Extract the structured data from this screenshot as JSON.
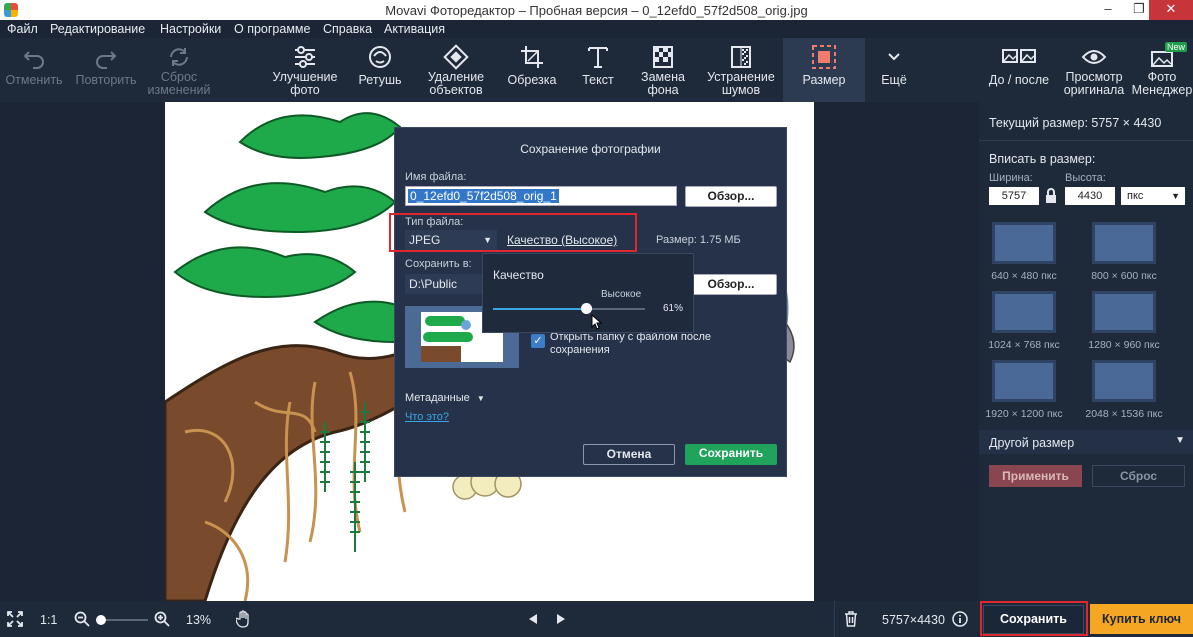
{
  "window": {
    "title": "Movavi Фоторедактор – Пробная версия – 0_12efd0_57f2d508_orig.jpg"
  },
  "menu": [
    "Файл",
    "Редактирование",
    "Настройки",
    "О программе",
    "Справка",
    "Активация"
  ],
  "toolbar": {
    "undo": "Отменить",
    "redo": "Повторить",
    "reset": [
      "Сброс",
      "изменений"
    ],
    "tools": [
      {
        "label": [
          "Улучшение",
          "фото"
        ]
      },
      {
        "label": [
          "Ретушь"
        ]
      },
      {
        "label": [
          "Удаление",
          "объектов"
        ]
      },
      {
        "label": [
          "Обрезка"
        ]
      },
      {
        "label": [
          "Текст"
        ]
      },
      {
        "label": [
          "Замена",
          "фона"
        ]
      },
      {
        "label": [
          "Устранение",
          "шумов"
        ]
      },
      {
        "label": [
          "Размер"
        ]
      },
      {
        "label": [
          "Ещё"
        ]
      }
    ],
    "before_after": "До / после",
    "view_original": [
      "Просмотр",
      "оригинала"
    ],
    "photo_manager": [
      "Фото",
      "Менеджер"
    ],
    "new_badge": "New"
  },
  "right_panel": {
    "current_size": "Текущий размер: 5757 × 4430",
    "fit_to_size": "Вписать в размер:",
    "width_label": "Ширина:",
    "height_label": "Высота:",
    "width_value": "5757",
    "height_value": "4430",
    "unit": "пкс",
    "presets": [
      "640 × 480 пкс",
      "800 × 600 пкс",
      "1024 × 768 пкс",
      "1280 × 960 пкс",
      "1920 × 1200 пкс",
      "2048 × 1536 пкс"
    ],
    "other_size": "Другой размер",
    "apply": "Применить",
    "reset": "Сброс"
  },
  "dialog": {
    "title": "Сохранение фотографии",
    "filename_label": "Имя файла:",
    "filename_value": "0_12efd0_57f2d508_orig_1",
    "browse": "Обзор...",
    "filetype_label": "Тип файла:",
    "filetype_value": "JPEG",
    "quality_link": "Качество (Высокое)",
    "size": "Размер: 1.75 МБ",
    "save_to_label": "Сохранить в:",
    "save_to_value": "D:\\Public",
    "browse2": "Обзор...",
    "open_folder": [
      "Открыть папку с файлом после",
      "сохранения"
    ],
    "metadata": "Метаданные",
    "what_is": "Что это?",
    "cancel": "Отмена",
    "save": "Сохранить"
  },
  "quality_popup": {
    "title": "Качество",
    "level": "Высокое",
    "percent": "61%",
    "value": 0.61
  },
  "bottom": {
    "one_to_one": "1:1",
    "zoom": "13%",
    "dimensions": "5757×4430",
    "save": "Сохранить",
    "buy": "Купить ключ"
  },
  "colors": {
    "accent_green": "#20a35a",
    "buy_orange": "#f5a623",
    "highlight_red": "#e0262f"
  }
}
